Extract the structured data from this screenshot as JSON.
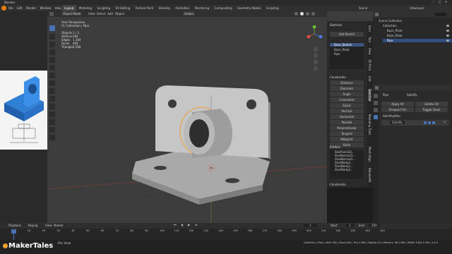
{
  "app": {
    "window_title": "Blender",
    "menu": [
      "File",
      "Edit",
      "Render",
      "Window",
      "Help"
    ],
    "workspaces": [
      "Layout",
      "Modeling",
      "Sculpting",
      "UV Editing",
      "Texture Paint",
      "Shading",
      "Animation",
      "Rendering",
      "Compositing",
      "Geometry Nodes",
      "Scripting"
    ],
    "active_workspace": "Layout",
    "scene": "Scene",
    "view_layer": "ViewLayer"
  },
  "viewport": {
    "mode": "Object Mode",
    "menus": [
      "View",
      "Select",
      "Add",
      "Object"
    ],
    "transform": "Global",
    "info_lines": [
      "User Perspective",
      "(1) Collection | Pipe"
    ],
    "stats": [
      {
        "label": "Objects",
        "value": "1 / 3"
      },
      {
        "label": "Vertices",
        "value": "784"
      },
      {
        "label": "Edges",
        "value": "1,184"
      },
      {
        "label": "Faces",
        "value": "404"
      },
      {
        "label": "Triangles",
        "value": "1,568"
      }
    ]
  },
  "sketcher": {
    "title": "Sketcher",
    "add_sketch": "Add Sketch",
    "sketches": [
      "Base_Sketch",
      "Base_Plate",
      "Pipe"
    ],
    "constraints_title": "Constraints",
    "constraints": [
      "Distance",
      "Diameter",
      "Angle",
      "Coincident",
      "Equal",
      "Vertical",
      "Horizontal",
      "Parallel",
      "Perpendicular",
      "Tangent",
      "Midpoint",
      "Ratio"
    ],
    "entities_title": "Entities",
    "entities": [
      "SlvsPoint3D...",
      "SlvsNormal3...",
      "SlvsNormal3...",
      "SlvsWorkpl...",
      "SlvsWorkpl...",
      "SlvsWorkpl..."
    ],
    "constraints_footer": "Constraints"
  },
  "side_tabs": [
    "Item",
    "Tool",
    "View",
    "3D Print",
    "Edit",
    "Sketcher",
    "Modeling Tools",
    "Mesh Align",
    "BlenderKit"
  ],
  "outliner": {
    "title": "Scene Collection",
    "items": [
      "Collection",
      "Base_Plate",
      "Base_Plate",
      "Pipe"
    ]
  },
  "properties": {
    "object_name": "Pipe",
    "modifier_name": "Solidify",
    "buttons": [
      "Apply All",
      "Delete All",
      "Viewport Vis",
      "Toggle Stack"
    ],
    "add_modifier": "Add Modifier",
    "modifier": "Solidify"
  },
  "timeline": {
    "menus": [
      "Playback",
      "Keying",
      "View",
      "Marker"
    ],
    "current_frame": "1",
    "start_label": "Start",
    "start": "1",
    "end_label": "End",
    "end": "250",
    "ticks": [
      "0",
      "10",
      "20",
      "30",
      "40",
      "50",
      "60",
      "70",
      "80",
      "90",
      "100",
      "110",
      "120",
      "130",
      "140",
      "150",
      "160",
      "170",
      "180",
      "190",
      "200",
      "210",
      "220",
      "230",
      "240",
      "250"
    ]
  },
  "status": {
    "left": "Pan View",
    "right": "Collection | Pipe | Verts:784 | Faces:404 | Tris:1,568 | Objects:1/3 | Memory: 98.2 MiB | VRAM: 0.8/4.0 GiB | 3.3.0"
  },
  "watermark": "MakerTales",
  "colors": {
    "accent": "#4772b3",
    "active_orange": "#f0a030",
    "mesh": "#b9b9b9",
    "part_blue": "#2f7fd6"
  }
}
